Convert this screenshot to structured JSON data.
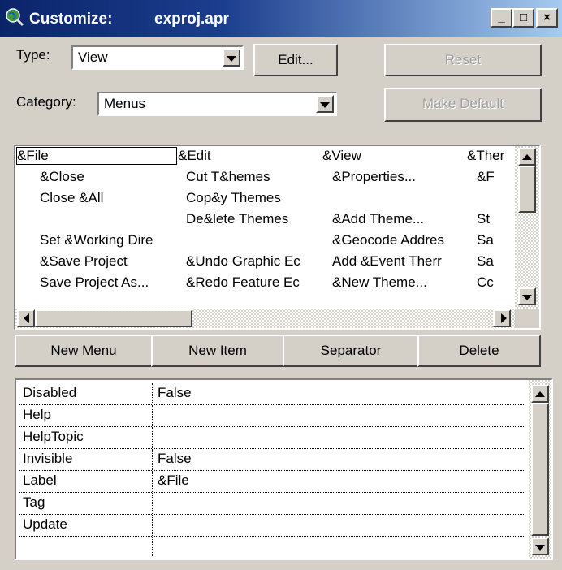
{
  "window": {
    "title_prefix": "Customize:",
    "title_file": "exproj.apr",
    "icon": "globe-magnifier-icon",
    "controls": {
      "minimize": "_",
      "maximize": "□",
      "close": "×"
    }
  },
  "type": {
    "label": "Type:",
    "value": "View"
  },
  "category": {
    "label": "Category:",
    "value": "Menus"
  },
  "buttons": {
    "edit": "Edit...",
    "reset": "Reset",
    "make_default": "Make Default",
    "new_menu": "New Menu",
    "new_item": "New Item",
    "separator": "Separator",
    "delete": "Delete"
  },
  "menu_grid": {
    "columns": [
      {
        "header": "&File",
        "items": [
          "&Close",
          "Close &All",
          "",
          "Set &Working Dire",
          "&Save Project",
          "Save Project As..."
        ]
      },
      {
        "header": "&Edit",
        "items": [
          "Cut T&hemes",
          "Cop&y Themes",
          "De&lete Themes",
          "",
          "&Undo Graphic Ec",
          "&Redo Feature Ec"
        ]
      },
      {
        "header": "&View",
        "items": [
          "&Properties...",
          "",
          "&Add Theme...",
          "&Geocode Addres",
          "Add &Event Therr",
          "&New Theme..."
        ]
      },
      {
        "header": "&Ther",
        "items": [
          "&F",
          "",
          "St",
          "Sa",
          "Sa",
          "Cc"
        ]
      }
    ]
  },
  "properties": [
    {
      "name": "Disabled",
      "value": "False"
    },
    {
      "name": "Help",
      "value": ""
    },
    {
      "name": "HelpTopic",
      "value": ""
    },
    {
      "name": "Invisible",
      "value": "False"
    },
    {
      "name": "Label",
      "value": "&File"
    },
    {
      "name": "Tag",
      "value": ""
    },
    {
      "name": "Update",
      "value": ""
    },
    {
      "name": "",
      "value": ""
    }
  ],
  "colors": {
    "titlebar_start": "#0a246a",
    "titlebar_end": "#a6caf0",
    "face": "#d4d0c8"
  }
}
